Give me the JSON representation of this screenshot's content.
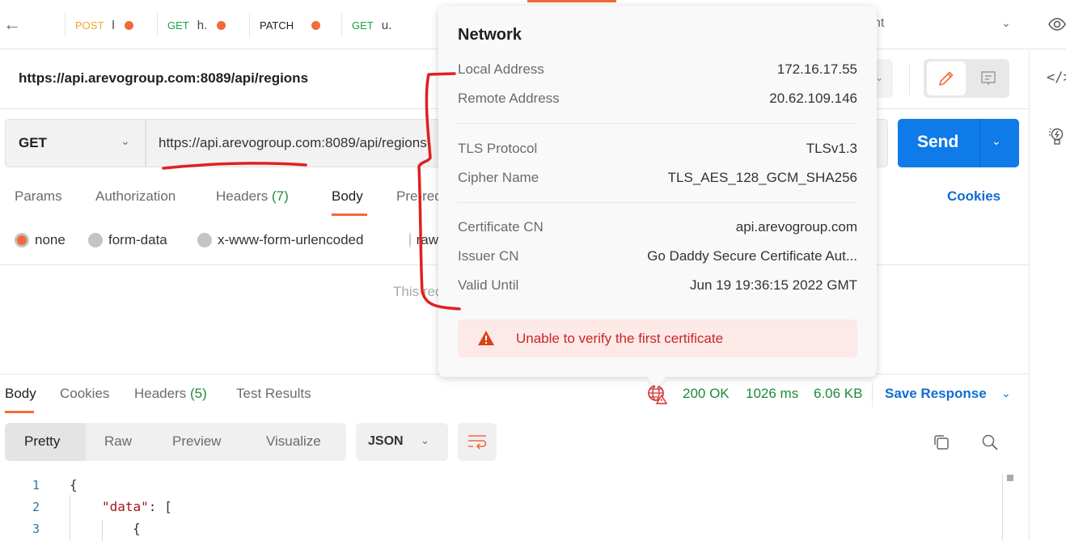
{
  "tabbar": {
    "tabs": [
      {
        "method": "POST",
        "method_color": "#f5a623",
        "name": "l",
        "unsaved": true
      },
      {
        "method": "GET",
        "method_color": "#1e9e4a",
        "name": "h.",
        "unsaved": true
      },
      {
        "method": "PATCH",
        "method_color": "#212121",
        "name": "",
        "unsaved": true
      },
      {
        "method": "GET",
        "method_color": "#1e9e4a",
        "name": "u.",
        "unsaved": false
      }
    ],
    "environment_partial": "nt"
  },
  "request": {
    "title": "https://api.arevogroup.com:8089/api/regions",
    "method": "GET",
    "url": "https://api.arevogroup.com:8089/api/regions",
    "send_label": "Send",
    "tabs": [
      {
        "label": "Params"
      },
      {
        "label": "Authorization"
      },
      {
        "label": "Headers",
        "count": "(7)"
      },
      {
        "label": "Body",
        "active": true
      },
      {
        "label": "Pre-request Script"
      }
    ],
    "cookies_label": "Cookies",
    "body_types": [
      {
        "label": "none",
        "selected": true
      },
      {
        "label": "form-data"
      },
      {
        "label": "x-www-form-urlencoded"
      },
      {
        "label": "raw"
      }
    ],
    "empty_note": "This request does not have a body"
  },
  "response": {
    "tabs": [
      {
        "label": "Body",
        "active": true
      },
      {
        "label": "Cookies"
      },
      {
        "label": "Headers",
        "count": "(5)"
      },
      {
        "label": "Test Results"
      }
    ],
    "status": "200 OK",
    "time": "1026 ms",
    "size": "6.06 KB",
    "save_label": "Save Response",
    "views": [
      "Pretty",
      "Raw",
      "Preview",
      "Visualize"
    ],
    "format": "JSON",
    "code": [
      {
        "n": "1",
        "text": "{"
      },
      {
        "n": "2",
        "key": "\"data\"",
        "rest": ": ["
      },
      {
        "n": "3",
        "text": "{"
      }
    ]
  },
  "network_popover": {
    "title": "Network",
    "rows": [
      {
        "label": "Local Address",
        "value": "172.16.17.55"
      },
      {
        "label": "Remote Address",
        "value": "20.62.109.146"
      },
      {
        "label": "TLS Protocol",
        "value": "TLSv1.3"
      },
      {
        "label": "Cipher Name",
        "value": "TLS_AES_128_GCM_SHA256"
      },
      {
        "label": "Certificate CN",
        "value": "api.arevogroup.com"
      },
      {
        "label": "Issuer CN",
        "value": "Go Daddy Secure Certificate Aut..."
      },
      {
        "label": "Valid Until",
        "value": "Jun 19 19:36:15 2022 GMT"
      }
    ],
    "warning": "Unable to verify the first certificate"
  },
  "colors": {
    "accent": "#f26b3a",
    "primary": "#0e7be8",
    "success": "#1e8a3c",
    "error": "#c62828",
    "annotation": "#e02020"
  }
}
